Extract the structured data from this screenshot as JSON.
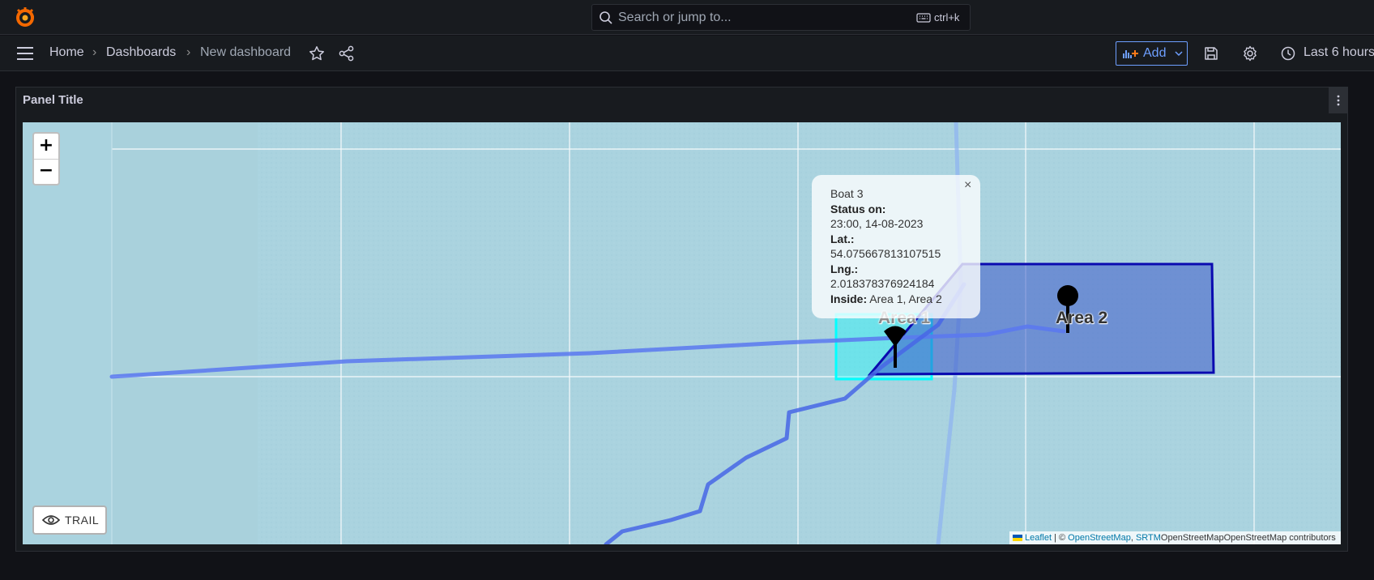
{
  "topbar": {
    "search_placeholder": "Search or jump to...",
    "shortcut": "ctrl+k"
  },
  "navbar": {
    "breadcrumbs": [
      "Home",
      "Dashboards",
      "New dashboard"
    ],
    "add_label": "Add",
    "time_range": "Last 6 hours"
  },
  "panel": {
    "title": "Panel Title",
    "map": {
      "zoom_in": "+",
      "zoom_out": "−",
      "trail_label": "TRAIL",
      "area_labels": [
        "Area 1",
        "Area 2"
      ],
      "popup": {
        "close": "×",
        "name": "Boat 3",
        "status_label": "Status on:",
        "status_value": "23:00, 14-08-2023",
        "lat_label": "Lat.:",
        "lat_value": "54.075667813107515",
        "lng_label": "Lng.:",
        "lng_value": "2.018378376924184",
        "inside_label": "Inside:",
        "inside_value": "Area 1, Area 2"
      },
      "attribution": {
        "leaflet": "Leaflet",
        "separator": " | © ",
        "osm": "OpenStreetMap",
        "comma": ", ",
        "srtm": "SRTM",
        "rest": "OpenStreetMapOpenStreetMap contributors"
      }
    }
  },
  "colors": {
    "accent": "#6e9fff",
    "sea": "#aad3df",
    "track": "#3d5be3",
    "area1": "#00ffff",
    "area2": "#0000aa"
  }
}
